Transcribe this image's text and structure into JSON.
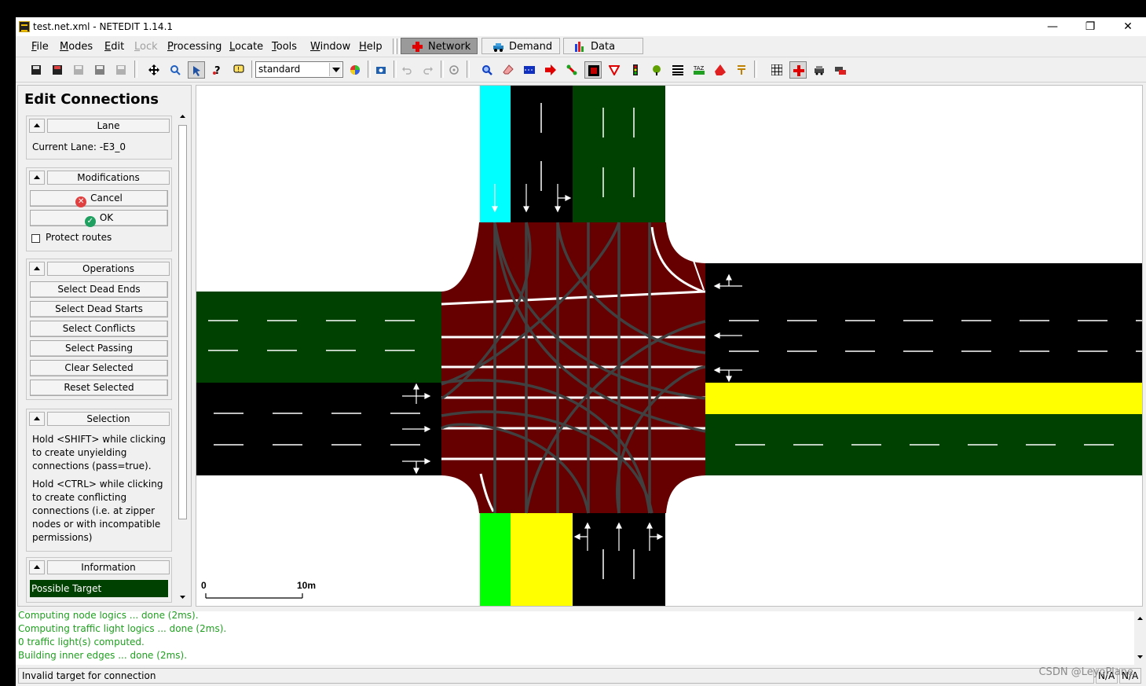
{
  "window": {
    "title": "test.net.xml - NETEDIT 1.14.1",
    "controls": [
      "—",
      "❐",
      "✕"
    ]
  },
  "menu": {
    "items": [
      "File",
      "Modes",
      "Edit",
      "Lock",
      "Processing",
      "Locate",
      "Tools",
      "Window",
      "Help"
    ],
    "disabled": [
      "Lock"
    ]
  },
  "supermodes": [
    {
      "label": "Network",
      "active": true,
      "icon": "network-cross-icon"
    },
    {
      "label": "Demand",
      "active": false,
      "icon": "demand-car-icon"
    },
    {
      "label": "Data",
      "active": false,
      "icon": "data-bars-icon"
    }
  ],
  "toolbar": {
    "scheme_select_value": "standard",
    "active_tool": "select-mode",
    "active_network_mode": "connect-mode"
  },
  "left_panel": {
    "frame_title": "Edit Connections",
    "lane_group": {
      "title": "Lane",
      "current_lane": "Current Lane: -E3_0"
    },
    "modifications_group": {
      "title": "Modifications",
      "cancel": "Cancel",
      "ok": "OK",
      "protect_routes": "Protect routes",
      "protect_checked": false
    },
    "operations_group": {
      "title": "Operations",
      "buttons": [
        "Select Dead Ends",
        "Select Dead Starts",
        "Select Conflicts",
        "Select Passing",
        "Clear Selected",
        "Reset Selected"
      ]
    },
    "selection_group": {
      "title": "Selection",
      "text1": [
        "Hold <SHIFT> while clicking",
        "to create unyielding",
        "connections (pass=true)."
      ],
      "text2": [
        "Hold <CTRL> while clicking",
        "to create conflicting",
        "connections (i.e. at zipper",
        "nodes or with incompatible",
        "permissions)"
      ]
    },
    "information_group": {
      "title": "Information",
      "legend": "Possible Target",
      "legend_color": "#004000"
    }
  },
  "view": {
    "scale_start": "0",
    "scale_end": "10m",
    "colors": {
      "junction": "#660000",
      "road": "#000000",
      "source_lane": "#00ffff",
      "possible_target": "#004000",
      "target": "#00ff00",
      "conflict": "#ffff00",
      "background": "#ffffff"
    }
  },
  "log": {
    "lines": [
      "Computing node logics ... done (2ms).",
      "Computing traffic light logics ... done (2ms).",
      " 0 traffic light(s) computed.",
      "Building inner edges ... done (2ms)."
    ]
  },
  "status": {
    "message": "Invalid target for connection",
    "coord1": "N/A",
    "coord2": "N/A"
  },
  "watermark": "CSDN @LeyoPlane"
}
